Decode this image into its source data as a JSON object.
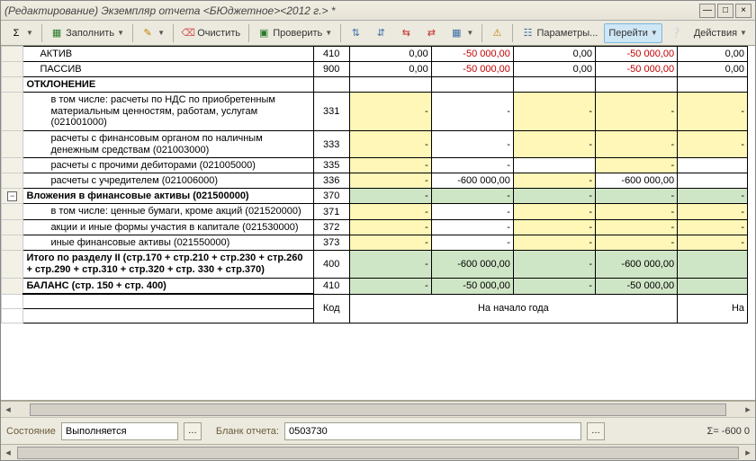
{
  "title": "(Редактирование) Экземпляр отчета <БЮджетное><2012 г.> *",
  "toolbar": {
    "fill": "Заполнить",
    "clear": "Очистить",
    "check": "Проверить",
    "params": "Параметры...",
    "goto": "Перейти",
    "actions": "Действия"
  },
  "rows": [
    {
      "name": "АКТИВ",
      "indent": 1,
      "code": "410",
      "vals": [
        "0,00",
        "-50 000,00",
        "0,00",
        "-50 000,00",
        "0,00"
      ],
      "fmt": [
        "",
        "red",
        "",
        "red",
        ""
      ]
    },
    {
      "name": "ПАССИВ",
      "indent": 1,
      "code": "900",
      "vals": [
        "0,00",
        "-50 000,00",
        "0,00",
        "-50 000,00",
        "0,00"
      ],
      "fmt": [
        "",
        "red",
        "",
        "red",
        ""
      ]
    },
    {
      "name": "ОТКЛОНЕНИЕ",
      "bold": true,
      "indent": 0,
      "code": "",
      "vals": [
        "",
        "",
        "",
        "",
        ""
      ],
      "fmt": [
        "",
        "",
        "",
        "",
        ""
      ]
    },
    {
      "name": "в том числе:\nрасчеты по НДС по приобретенным материальным ценностям, работам, услугам (021001000)",
      "indent": 2,
      "wrap": true,
      "code": "331",
      "vals": [
        "-",
        "-",
        "-",
        "-",
        "-"
      ],
      "bg": [
        "y",
        "",
        "y",
        "y",
        "y"
      ]
    },
    {
      "name": "расчеты с финансовым органом по наличным денежным средствам (021003000)",
      "indent": 2,
      "wrap": true,
      "code": "333",
      "vals": [
        "-",
        "-",
        "-",
        "-",
        "-"
      ],
      "bg": [
        "y",
        "",
        "y",
        "y",
        "y"
      ]
    },
    {
      "name": "расчеты с прочими дебиторами (021005000)",
      "indent": 2,
      "code": "335",
      "vals": [
        "-",
        "-",
        "",
        "-",
        ""
      ],
      "bg": [
        "y",
        "",
        "",
        "y",
        ""
      ]
    },
    {
      "name": "расчеты с учредителем (021006000)",
      "indent": 2,
      "code": "336",
      "vals": [
        "-",
        "-600 000,00",
        "-",
        "-600 000,00",
        ""
      ],
      "bg": [
        "y",
        "",
        "y",
        "",
        ""
      ]
    },
    {
      "name": "Вложения в финансовые активы (021500000)",
      "bold": true,
      "indent": 0,
      "exp": true,
      "code": "370",
      "vals": [
        "-",
        "-",
        "-",
        "-",
        "-"
      ],
      "bg": [
        "g",
        "g",
        "g",
        "g",
        "g"
      ]
    },
    {
      "name": "в том числе:\nценные бумаги, кроме акций (021520000)",
      "indent": 2,
      "wrap": true,
      "code": "371",
      "vals": [
        "-",
        "-",
        "-",
        "-",
        "-"
      ],
      "bg": [
        "y",
        "",
        "y",
        "y",
        "y"
      ]
    },
    {
      "name": "акции и иные формы участия в капитале (021530000)",
      "indent": 2,
      "wrap": true,
      "code": "372",
      "vals": [
        "-",
        "-",
        "-",
        "-",
        "-"
      ],
      "bg": [
        "y",
        "",
        "y",
        "y",
        "y"
      ]
    },
    {
      "name": "иные финансовые активы (021550000)",
      "indent": 2,
      "code": "373",
      "vals": [
        "-",
        "-",
        "-",
        "-",
        "-"
      ],
      "bg": [
        "y",
        "",
        "y",
        "y",
        "y"
      ]
    },
    {
      "name": "Итого по разделу II\n(стр.170 + стр.210 + стр.230 + стр.260 + стр.290 + стр.310 + стр.320 + стр. 330 + стр.370)",
      "bold": true,
      "indent": 0,
      "wrap": true,
      "code": "400",
      "vals": [
        "-",
        "-600 000,00",
        "-",
        "-600 000,00",
        ""
      ],
      "bg": [
        "g",
        "g",
        "g",
        "g",
        "g"
      ]
    },
    {
      "name": "БАЛАНС\n(стр. 150 + стр. 400)",
      "bold": true,
      "indent": 0,
      "wrap": true,
      "code": "410",
      "vals": [
        "-",
        "-50 000,00",
        "-",
        "-50 000,00",
        ""
      ],
      "bg": [
        "g",
        "g",
        "g",
        "g",
        "g"
      ]
    }
  ],
  "footer": {
    "code_label": "Код",
    "period_label": "На начало года",
    "period_right": "На"
  },
  "status": {
    "state_label": "Состояние",
    "state_value": "Выполняется",
    "blank_label": "Бланк отчета:",
    "blank_value": "0503730",
    "sigma": "Σ=  -600 0"
  }
}
